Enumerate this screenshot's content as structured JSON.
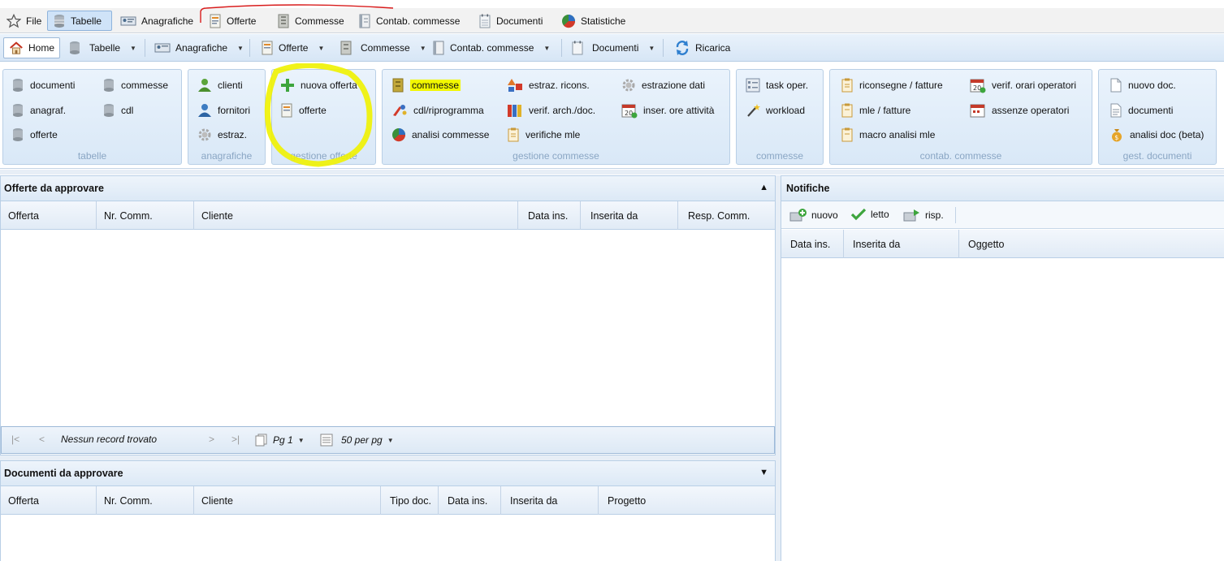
{
  "menubar": {
    "items": [
      "File",
      "Tabelle",
      "Anagrafiche",
      "Offerte",
      "Commesse",
      "Contab. commesse",
      "Documenti",
      "Statistiche"
    ],
    "active": "Tabelle"
  },
  "toolbar": {
    "items": [
      "Home",
      "Tabelle",
      "Anagrafiche",
      "Offerte",
      "Commesse",
      "Contab. commesse",
      "Documenti",
      "Ricarica"
    ]
  },
  "ribbon": {
    "tabelle": {
      "title": "tabelle",
      "items": [
        "documenti",
        "commesse",
        "anagraf.",
        "cdl",
        "offerte"
      ]
    },
    "anagrafiche": {
      "title": "anagrafiche",
      "items": [
        "clienti",
        "fornitori",
        "estraz."
      ]
    },
    "gestione_offerte": {
      "title": "gestione offerte",
      "items": [
        "nuova offerta",
        "offerte"
      ]
    },
    "gestione_commesse": {
      "title": "gestione commesse",
      "items": [
        "commesse",
        "estraz. ricons.",
        "estrazione dati",
        "cdl/riprogramma",
        "verif. arch./doc.",
        "inser. ore attività",
        "analisi commesse",
        "verifiche mle"
      ]
    },
    "commesse": {
      "title": "commesse",
      "items": [
        "task oper.",
        "workload"
      ]
    },
    "contab_commesse": {
      "title": "contab. commesse",
      "items": [
        "riconsegne / fatture",
        "verif. orari operatori",
        "mle / fatture",
        "assenze operatori",
        "macro analisi mle"
      ]
    },
    "gest_documenti": {
      "title": "gest. documenti",
      "items": [
        "nuovo doc.",
        "documenti",
        "analisi doc (beta)"
      ]
    }
  },
  "offerte_panel": {
    "title": "Offerte da approvare",
    "columns": [
      "Offerta",
      "Nr. Comm.",
      "Cliente",
      "Data ins.",
      "Inserita da",
      "Resp. Comm."
    ],
    "rows": [],
    "pager": {
      "status": "Nessun record trovato",
      "page": "Pg 1",
      "per_page": "50 per pg"
    }
  },
  "documenti_panel": {
    "title": "Documenti da approvare",
    "columns": [
      "Offerta",
      "Nr. Comm.",
      "Cliente",
      "Tipo doc.",
      "Data ins.",
      "Inserita da",
      "Progetto"
    ],
    "rows": []
  },
  "notifiche_panel": {
    "title": "Notifiche",
    "actions": [
      "nuovo",
      "letto",
      "risp."
    ],
    "columns": [
      "Data ins.",
      "Inserita da",
      "Oggetto"
    ],
    "rows": []
  }
}
